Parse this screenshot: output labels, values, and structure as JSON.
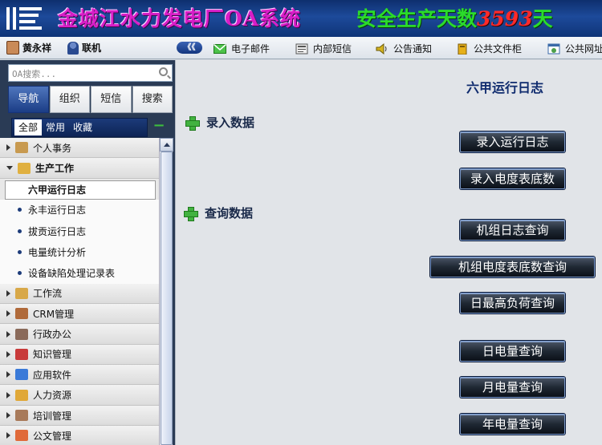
{
  "banner": {
    "company": "金城江水力发电厂OA系统",
    "safety_prefix": "安全生产天数",
    "safety_days": "3593",
    "safety_suffix": "天"
  },
  "toolbar": {
    "user_name": "黄永祥",
    "status": "联机",
    "collapse_glyph": "《《",
    "items": [
      {
        "label": "电子邮件",
        "icon": "mail-icon"
      },
      {
        "label": "内部短信",
        "icon": "sms-icon"
      },
      {
        "label": "公告通知",
        "icon": "speaker-icon"
      },
      {
        "label": "公共文件柜",
        "icon": "folder-icon"
      },
      {
        "label": "公共网址",
        "icon": "web-icon"
      }
    ]
  },
  "sidebar": {
    "search_placeholder": "OA搜索...",
    "tabs": [
      "导航",
      "组织",
      "短信",
      "搜索"
    ],
    "active_tab": "导航",
    "subtabs": [
      "全部",
      "常用",
      "收藏"
    ],
    "active_subtab": "全部",
    "tree": [
      {
        "label": "个人事务",
        "icon": "person-icon"
      },
      {
        "label": "生产工作",
        "icon": "production-icon",
        "open": true,
        "children": [
          "六甲运行日志",
          "永丰运行日志",
          "拔贡运行日志",
          "电量统计分析",
          "设备缺陷处理记录表"
        ],
        "current": "六甲运行日志"
      },
      {
        "label": "工作流",
        "icon": "workflow-icon"
      },
      {
        "label": "CRM管理",
        "icon": "crm-icon"
      },
      {
        "label": "行政办公",
        "icon": "admin-icon"
      },
      {
        "label": "知识管理",
        "icon": "book-icon"
      },
      {
        "label": "应用软件",
        "icon": "computer-icon"
      },
      {
        "label": "人力资源",
        "icon": "hr-icon"
      },
      {
        "label": "培训管理",
        "icon": "training-icon"
      },
      {
        "label": "公文管理",
        "icon": "document-icon"
      }
    ]
  },
  "main": {
    "title": "六甲运行日志",
    "section_entry": "录入数据",
    "section_query": "查询数据",
    "buttons": [
      "录入运行日志",
      "录入电度表底数",
      "机组日志查询",
      "机组电度表底数查询",
      "日最高负荷查询",
      "日电量查询",
      "月电量查询",
      "年电量查询"
    ]
  },
  "colors": {
    "banner": "#1d4a9a",
    "company_text": "#d81ec8",
    "safety_text": "#2bdb2b",
    "days_text": "#ff2a2a",
    "title_text": "#0f2b6e",
    "plus_green": "#42b240"
  }
}
